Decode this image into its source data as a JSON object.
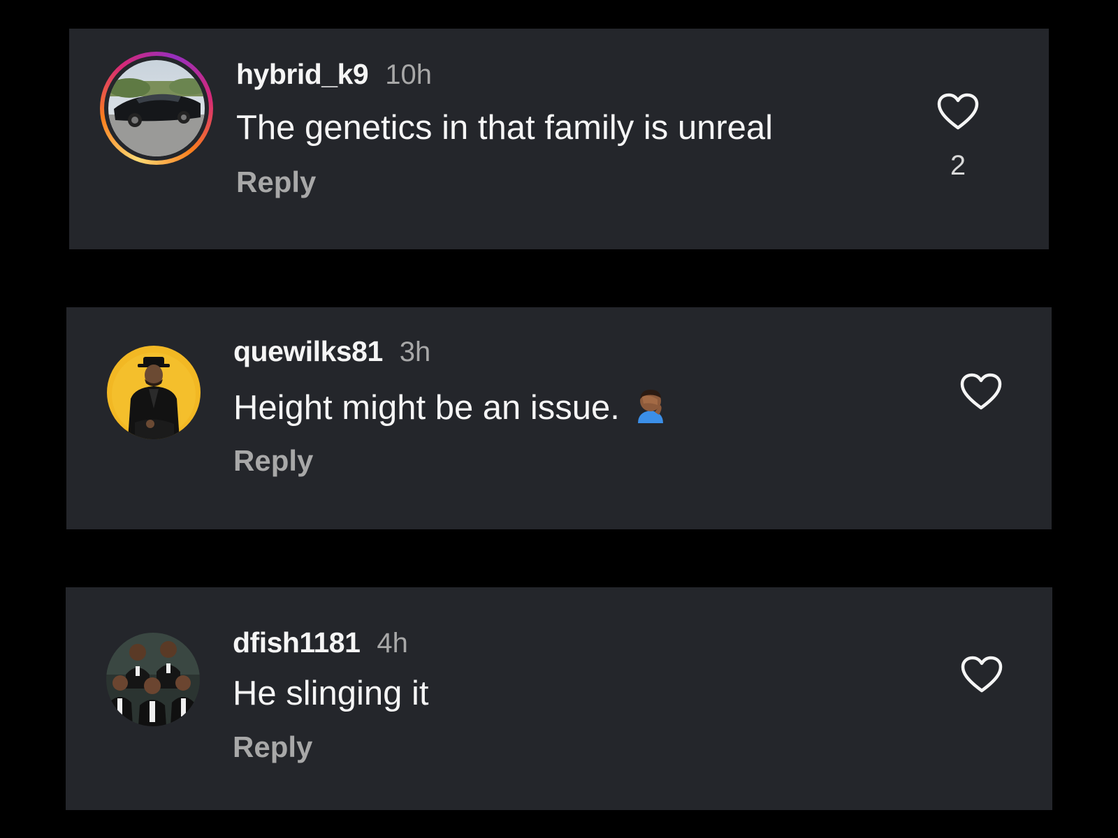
{
  "comments": [
    {
      "username": "hybrid_k9",
      "time": "10h",
      "text": "The genetics in that family is unreal",
      "reply_label": "Reply",
      "like_count": "2",
      "avatar_icon": "car-photo-avatar",
      "has_story_ring": true
    },
    {
      "username": "quewilks81",
      "time": "3h",
      "text": "Height might be an issue.",
      "emoji_icon": "facepalm-emoji-icon",
      "reply_label": "Reply",
      "avatar_icon": "man-in-hat-avatar",
      "has_story_ring": false
    },
    {
      "username": "dfish1181",
      "time": "4h",
      "text": "He slinging it",
      "reply_label": "Reply",
      "avatar_icon": "group-illustration-avatar",
      "has_story_ring": false
    }
  ],
  "colors": {
    "background": "#000000",
    "card": "#24262b",
    "primary_text": "#f5f5f5",
    "secondary_text": "#a8a8a8",
    "story_ring_gradient": [
      "#feda75",
      "#fa7e1e",
      "#d62976",
      "#962fbf"
    ],
    "avatar_yellow": "#f2b824"
  }
}
